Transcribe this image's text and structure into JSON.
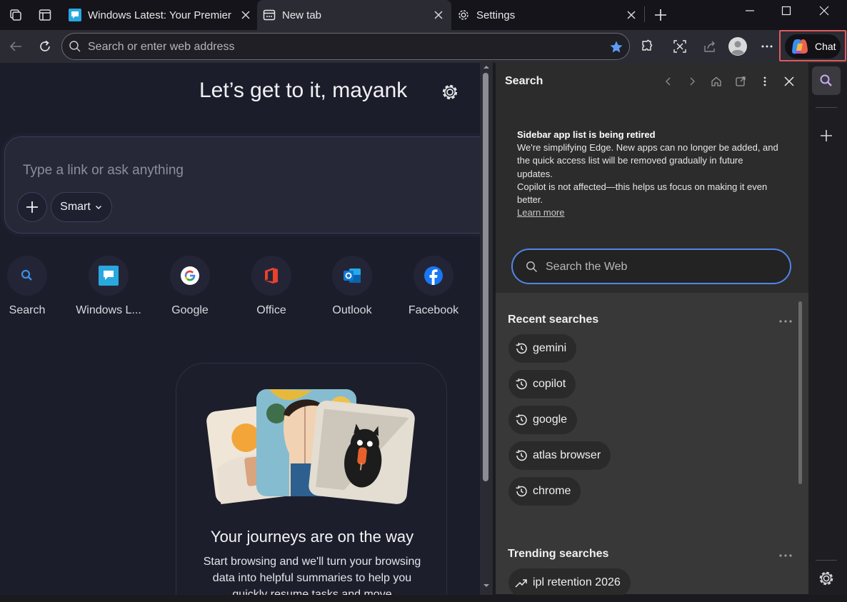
{
  "titlebar": {
    "tabs": [
      {
        "title": "Windows Latest: Your Premier Source",
        "icon": "windows-latest-favicon"
      },
      {
        "title": "New tab",
        "icon": "new-tab-icon"
      },
      {
        "title": "Settings",
        "icon": "gear-icon"
      }
    ]
  },
  "toolbar": {
    "address_placeholder": "Search or enter web address",
    "chat_label": "Chat"
  },
  "ntp": {
    "greeting": "Let’s get to it, mayank",
    "ask_placeholder": "Type a link or ask anything",
    "smart_label": "Smart",
    "tiles": [
      {
        "label": "Search",
        "icon": "search-icon"
      },
      {
        "label": "Windows L...",
        "icon": "windows-latest-icon"
      },
      {
        "label": "Google",
        "icon": "google-icon"
      },
      {
        "label": "Office",
        "icon": "office-icon"
      },
      {
        "label": "Outlook",
        "icon": "outlook-icon"
      },
      {
        "label": "Facebook",
        "icon": "facebook-icon"
      }
    ],
    "journey_title": "Your journeys are on the way",
    "journey_text": "Start browsing and we'll turn your browsing data into helpful summaries to help you quickly resume tasks and move"
  },
  "sidebar": {
    "title": "Search",
    "notice_heading": "Sidebar app list is being retired",
    "notice_body": "We're simplifying Edge. New apps can no longer be added, and the quick access list will be removed gradually in future updates.",
    "notice_body2": "Copilot is not affected—this helps us focus on making it even better.",
    "learn_more": "Learn more",
    "search_placeholder": "Search the Web",
    "recent_title": "Recent searches",
    "recent": [
      "gemini",
      "copilot",
      "google",
      "atlas browser",
      "chrome"
    ],
    "trending_title": "Trending searches",
    "trending": [
      "ipl retention 2026"
    ]
  },
  "colors": {
    "accent": "#4f86e8",
    "highlight_box": "#e05a5a"
  }
}
